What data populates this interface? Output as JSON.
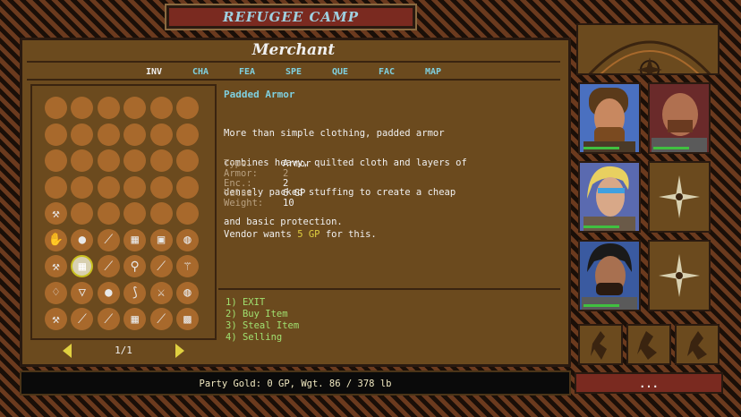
{
  "window": {
    "title": "REFUGEE CAMP"
  },
  "shop": {
    "title": "Merchant"
  },
  "tabs": [
    {
      "label": "INV",
      "active": true
    },
    {
      "label": "CHA",
      "active": false
    },
    {
      "label": "FEA",
      "active": false
    },
    {
      "label": "SPE",
      "active": false
    },
    {
      "label": "QUE",
      "active": false
    },
    {
      "label": "FAC",
      "active": false
    },
    {
      "label": "MAP",
      "active": false
    }
  ],
  "inventory": {
    "page": "1/1",
    "slots": [
      "",
      "",
      "",
      "",
      "",
      "",
      "",
      "",
      "",
      "",
      "",
      "",
      "",
      "",
      "",
      "",
      "",
      "",
      "",
      "",
      "",
      "",
      "",
      "",
      "axe-icon",
      "",
      "",
      "",
      "",
      "",
      "gauntlet-icon",
      "pouch-icon",
      "sickle-icon",
      "chainmail-icon",
      "tunic-icon",
      "bag-icon",
      "axe-icon",
      "padded-armor-icon",
      "sickle-icon",
      "mace-icon",
      "dagger-icon",
      "wand-icon",
      "horn-icon",
      "helm-icon",
      "pouch-icon",
      "bow-icon",
      "sword-icon",
      "bag-icon",
      "hammer-icon",
      "club-icon",
      "sickle-icon",
      "chainmail-icon",
      "dagger-icon",
      "plate-armor-icon"
    ],
    "selected_index": 37
  },
  "item": {
    "name": "Padded Armor",
    "description_lines": [
      "More than simple clothing, padded armor",
      "combines heavy, quilted cloth and layers of",
      "densely packed stuffing to create a cheap",
      "and basic protection."
    ],
    "stats": [
      {
        "label": "Type:",
        "value": "Armor"
      },
      {
        "label": "Armor:",
        "value": "2"
      },
      {
        "label": "Enc.:",
        "value": "2"
      },
      {
        "label": "Value:",
        "value": "6 GP"
      },
      {
        "label": "Weight:",
        "value": "10"
      }
    ],
    "vendor_prefix": "Vendor wants",
    "vendor_price": "5 GP",
    "vendor_suffix": "for this."
  },
  "options": [
    "1) EXIT",
    "2) Buy Item",
    "3) Steal Item",
    "4) Selling"
  ],
  "status": {
    "text": "Party Gold: 0 GP, Wgt. 86 / 378 lb"
  },
  "menu_button": {
    "label": "..."
  },
  "party": [
    {
      "slot": "portrait-1",
      "type": "hero"
    },
    {
      "slot": "portrait-2",
      "type": "hero"
    },
    {
      "slot": "portrait-3",
      "type": "hero"
    },
    {
      "slot": "portrait-4",
      "type": "empty"
    },
    {
      "slot": "portrait-5",
      "type": "hero"
    },
    {
      "slot": "portrait-6",
      "type": "empty"
    }
  ],
  "colors": {
    "accent": "#7fd0e0",
    "gold": "#e0d040",
    "option": "#a0e070",
    "title_bar": "#7a2a20",
    "panel": "#6b4a1e"
  }
}
